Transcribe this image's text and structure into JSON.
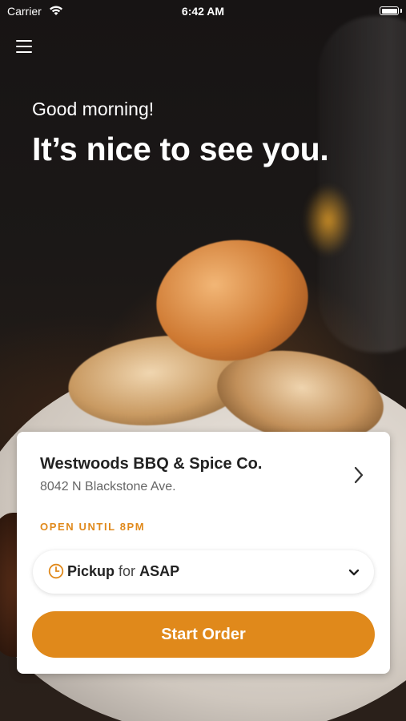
{
  "status_bar": {
    "carrier": "Carrier",
    "time": "6:42 AM",
    "wifi_icon": "wifi-icon",
    "battery_icon": "battery-icon"
  },
  "header": {
    "menu_icon": "hamburger-menu-icon",
    "greeting": "Good morning!",
    "headline": "It’s nice to see you."
  },
  "store": {
    "name": "Westwoods BBQ & Spice Co.",
    "address": "8042 N Blackstone Ave.",
    "hours": "OPEN UNTIL 8PM"
  },
  "order": {
    "method": "Pickup",
    "connector": "for",
    "time": "ASAP",
    "clock_icon": "clock-icon"
  },
  "actions": {
    "start_label": "Start Order"
  },
  "colors": {
    "accent": "#E0891B",
    "card_bg": "#FFFFFF",
    "text_dark": "#222222",
    "text_muted": "#666666"
  }
}
